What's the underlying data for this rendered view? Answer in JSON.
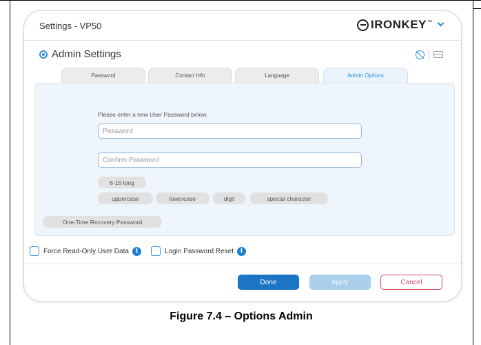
{
  "window": {
    "title": "Settings - VP50",
    "brand": "IRONKEY",
    "brand_tm": "™"
  },
  "section": {
    "title": "Admin Settings"
  },
  "tabs": [
    {
      "label": "Password",
      "active": false
    },
    {
      "label": "Contact Info",
      "active": false
    },
    {
      "label": "Language",
      "active": false
    },
    {
      "label": "Admin Options",
      "active": true
    }
  ],
  "form": {
    "prompt": "Please enter a new User Password below.",
    "password_placeholder": "Password",
    "confirm_placeholder": "Confirm Password",
    "rules": {
      "length": "6-16 long",
      "uppercase": "uppercase",
      "lowercase": "lowercase",
      "digit": "digit",
      "special": "special character"
    },
    "recovery_label": "One-Time Recovery Password"
  },
  "options": {
    "force_read_only": "Force Read-Only User Data",
    "login_password_reset": "Login Password Reset",
    "info_glyph": "i"
  },
  "buttons": {
    "done": "Done",
    "apply": "Apply",
    "cancel": "Cancel"
  },
  "caption": "Figure 7.4 – Options Admin",
  "colors": {
    "accent": "#2b8fd6",
    "primary_button": "#1b75c4",
    "disabled_button": "#a9cfec",
    "cancel": "#d84a63",
    "panel": "#eef5fb"
  },
  "icons": [
    "gear-icon",
    "eye-off-icon",
    "keyboard-icon",
    "chevron-down-icon",
    "info-icon"
  ]
}
